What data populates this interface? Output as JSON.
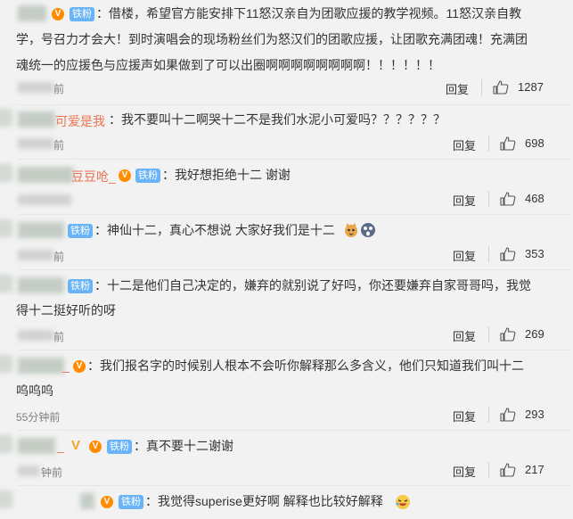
{
  "badges": {
    "vip": "V",
    "fan": "铁粉"
  },
  "reply_label": "回复",
  "comments": [
    {
      "name": "",
      "text_lines": [
        "：借楼，希望官方能安排下11怒汉亲自为团歌应援的教学视频。11怒汉亲自教",
        "学，号召力才会大！到时演唱会的现场粉丝们为怒汉们的团歌应援，让团歌充满团魂！充满团",
        "魂统一的应援色与应援声如果做到了可以出圈啊啊啊啊啊啊啊啊！！！！！！"
      ],
      "time": "前",
      "likes": "1287"
    },
    {
      "name": "可爱是我",
      "text_lines": [
        "：我不要叫十二啊哭十二不是我们水泥小可爱吗？？？？？？"
      ],
      "time": "前",
      "likes": "698"
    },
    {
      "name": "豆豆呛_",
      "text_lines": [
        "：我好想拒绝十二 谢谢"
      ],
      "time": "",
      "likes": "468"
    },
    {
      "name": "",
      "text_lines": [
        "：神仙十二，真心不想说  大家好我们是十二"
      ],
      "time": "前",
      "likes": "353"
    },
    {
      "name": "",
      "text_lines": [
        "：十二是他们自己决定的，嫌弃的就别说了好吗，你还要嫌弃自家哥哥吗，我觉",
        "得十二挺好听的呀"
      ],
      "time": "前",
      "likes": "269"
    },
    {
      "name": "",
      "text_lines": [
        "：我们报名字的时候别人根本不会听你解释那么多含义，他们只知道我们叫十二",
        "呜呜呜"
      ],
      "time": "55分钟前",
      "likes": "293"
    },
    {
      "name": "_",
      "text_lines": [
        "：真不要十二谢谢"
      ],
      "time": "钟前",
      "likes": "217"
    },
    {
      "name": "",
      "text_lines": [
        "：我觉得superise更好啊 解释也比较好解释"
      ],
      "time": "",
      "likes": ""
    }
  ],
  "colors": {
    "fan_badge": "#69b4f7",
    "vip": "#ff8c00",
    "name": "#eb7350"
  }
}
